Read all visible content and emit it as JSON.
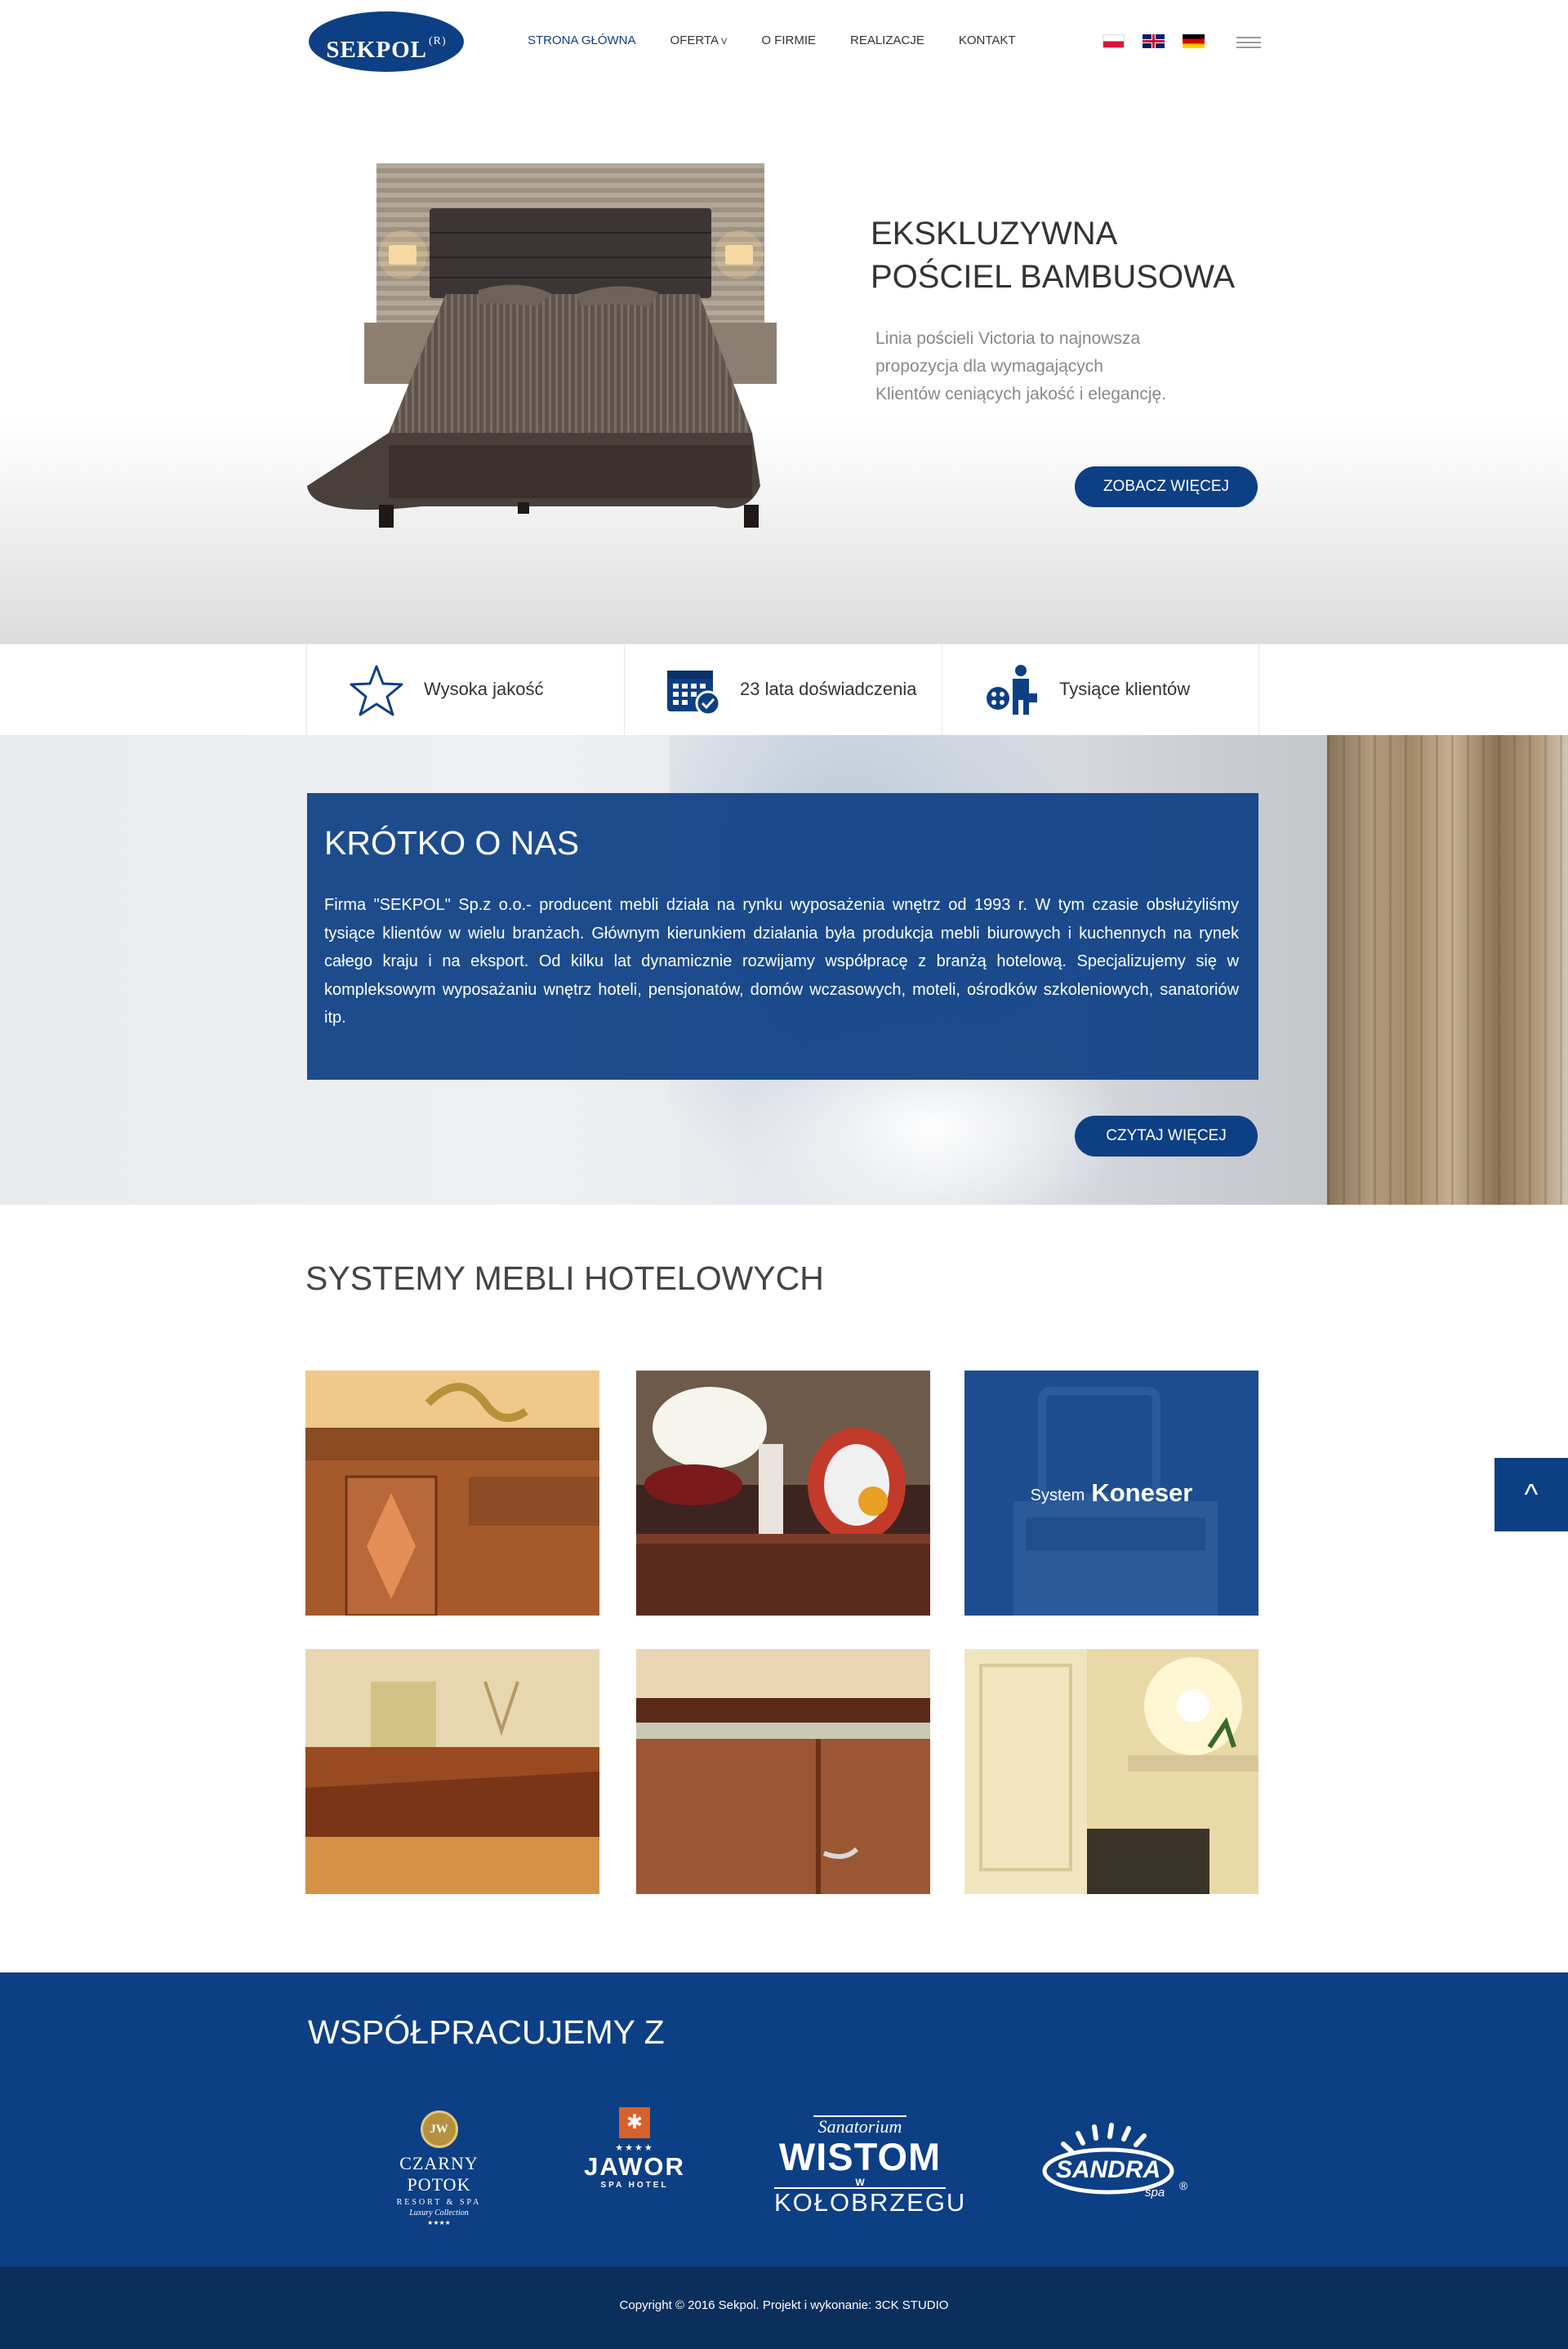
{
  "brand": {
    "logo_text": "SEKPOL",
    "logo_mark": "R",
    "accent_color": "#0d3f85"
  },
  "nav": {
    "items": [
      {
        "label": "STRONA GŁÓWNA",
        "active": true
      },
      {
        "label": "OFERTA",
        "has_dropdown": true,
        "chevron": "v"
      },
      {
        "label": "O FIRMIE"
      },
      {
        "label": "REALIZACJE"
      },
      {
        "label": "KONTAKT"
      }
    ],
    "languages": [
      {
        "code": "pl",
        "icon": "flag-pl-icon"
      },
      {
        "code": "en",
        "icon": "flag-gb-icon"
      },
      {
        "code": "de",
        "icon": "flag-de-icon"
      }
    ],
    "menu_icon": "hamburger-icon"
  },
  "hero": {
    "title_line1": "EKSKLUZYWNA",
    "title_line2": "POŚCIEL BAMBUSOWA",
    "text": "Linia pościeli Victoria to najnowsza propozycja dla wymagających Klientów ceniących jakość i elegancję.",
    "button": "ZOBACZ WIĘCEJ"
  },
  "features": [
    {
      "icon": "star-icon",
      "label": "Wysoka jakość"
    },
    {
      "icon": "calendar-check-icon",
      "label": "23 lata doświadczenia"
    },
    {
      "icon": "clients-group-icon",
      "label": "Tysiące klientów"
    }
  ],
  "about": {
    "title": "KRÓTKO O NAS",
    "text": "Firma \"SEKPOL\" Sp.z o.o.- producent mebli działa na rynku wyposażenia wnętrz od 1993 r. W tym czasie obsłużyliśmy tysiące klientów w wielu branżach. Głównym kierunkiem działania była produkcja mebli biurowych i kuchennych na rynek całego kraju i na eksport. Od kilku lat dynamicznie rozwijamy współpracę z branżą hotelową. Specjalizujemy się w kompleksowym wyposażaniu wnętrz hoteli, pensjonatów, domów wczasowych, moteli, ośrodków szkoleniowych, sanatoriów itp.",
    "button": "CZYTAJ  WIĘCEJ"
  },
  "systems": {
    "title": "SYSTEMY MEBLI HOTELOWYCH",
    "highlight_caption_a": "System",
    "highlight_caption_b": "Koneser"
  },
  "scroll_top": {
    "label": "^"
  },
  "partners": {
    "title": "WSPÓŁPRACUJEMY Z",
    "czarny_potok": {
      "seal": "JW",
      "name": "CZARNY POTOK",
      "sub": "RESORT & SPA",
      "tag": "Luxury Collection",
      "stars": "★★★★"
    },
    "jawor": {
      "stars": "★★★★",
      "name": "JAWOR",
      "sub": "SPA HOTEL"
    },
    "wistom": {
      "top": "Sanatorium",
      "name": "WISTOM",
      "w": "W",
      "city": "KOŁOBRZEGU"
    },
    "sandra": {
      "name": "SANDRA",
      "sub": "spa",
      "mark": "®"
    }
  },
  "footer": {
    "copyright": "Copyright © 2016 Sekpol. Projekt i wykonanie: 3CK STUDIO"
  }
}
